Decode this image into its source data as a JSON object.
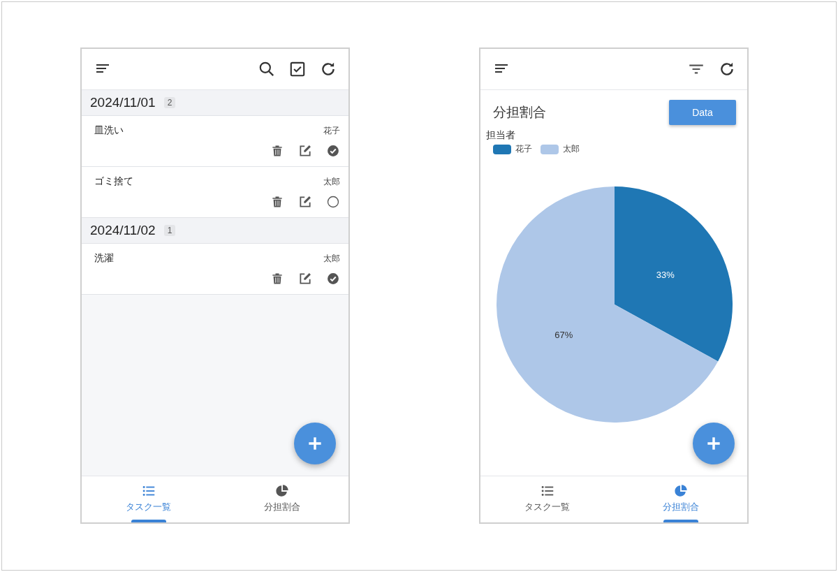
{
  "screens": [
    {
      "kind": "tasks",
      "groups": [
        {
          "date": "2024/11/01",
          "count": "2",
          "tasks": [
            {
              "name": "皿洗い",
              "assignee": "花子",
              "done": true
            },
            {
              "name": "ゴミ捨て",
              "assignee": "太郎",
              "done": false
            }
          ]
        },
        {
          "date": "2024/11/02",
          "count": "1",
          "tasks": [
            {
              "name": "洗濯",
              "assignee": "太郎",
              "done": true
            }
          ]
        }
      ],
      "tabs": [
        {
          "kind": "list",
          "label": "タスク一覧",
          "selected": true
        },
        {
          "kind": "pie",
          "label": "分担割合",
          "selected": false
        }
      ]
    },
    {
      "kind": "chart",
      "title": "分担割合",
      "data_button": "Data",
      "legend": {
        "title": "担当者",
        "items": [
          {
            "label": "花子",
            "color": "#1f77b4"
          },
          {
            "label": "太郎",
            "color": "#aec7e8"
          }
        ]
      },
      "chart_data": {
        "type": "pie",
        "values": [
          33,
          67
        ],
        "value_labels": [
          "33%",
          "67%"
        ]
      },
      "tabs": [
        {
          "kind": "list",
          "label": "タスク一覧",
          "selected": false
        },
        {
          "kind": "pie",
          "label": "分担割合",
          "selected": true
        }
      ]
    }
  ]
}
